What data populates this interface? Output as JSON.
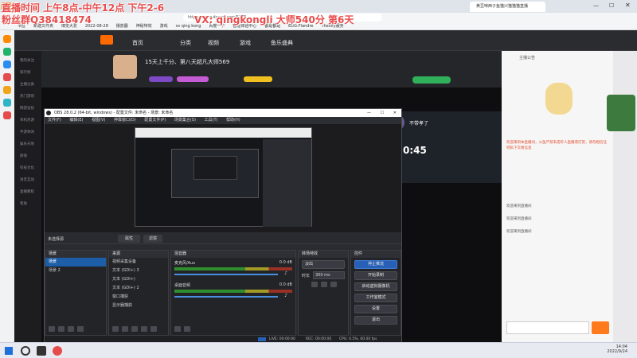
{
  "browser": {
    "tab_title": "黄豆咪西子鱼猫兴猫猫猫直播",
    "url": "https://www.douyu.com/5775",
    "bookmarks": [
      "书签",
      "新建文件夹",
      "博览大爱",
      "2022-08-28",
      "播放器",
      "神秘特效",
      "游戏",
      "sx qing kong",
      "百度一下",
      "智能体验中心",
      "都是都是",
      "EDG-Flandre",
      "Thestiy服务"
    ]
  },
  "overlay": {
    "line1": "直播时间 上午8点-中午12点 下午2-6",
    "line2": "粉丝群Q38418474",
    "line3": "VX: qingkongli 大师540分 第6天"
  },
  "site": {
    "nav": [
      "首页",
      "分类",
      "视频",
      "游戏",
      "鱼乐盛典"
    ],
    "sidebar": [
      "我的关注",
      "排行榜",
      "主播分类",
      "热门游戏",
      "网游竞技",
      "单机热游",
      "手游休闲",
      "娱乐天地",
      "颜值",
      "科技文化",
      "语音互动",
      "直播教程",
      "帮助"
    ],
    "room_title": "15天上千分、第八天超凡大师569",
    "streamer_card": {
      "name": "不带孝了",
      "timer": "0:45"
    },
    "right_panel": {
      "top_label": "主播公告",
      "chat": [
        "欢迎来到本直播间，斗鱼严禁未成年人直播或打赏，请勿相信任何私下交易信息",
        "欢迎来到直播间",
        "欢迎来到直播间",
        "欢迎来到直播间"
      ]
    }
  },
  "obs": {
    "title": "OBS 28.0.2 (64-bit, windows) - 配置文件: 未命名 - 场景: 未命名",
    "menu": [
      "文件(F)",
      "编辑(E)",
      "视图(V)",
      "停靠窗口(D)",
      "配置文件(P)",
      "场景集合(S)",
      "工具(T)",
      "帮助(H)"
    ],
    "source_bar": {
      "label": "未选择源",
      "props": "属性",
      "filters": "滤镜"
    },
    "docks": {
      "scenes": {
        "title": "场景",
        "items": [
          "场景",
          "场景 2"
        ]
      },
      "sources": {
        "title": "来源",
        "items": [
          "视频采集设备",
          "文本 (GDI+) 3",
          "文本 (GDI+)",
          "文本 (GDI+) 2",
          "窗口捕获",
          "显示器捕获"
        ]
      },
      "mixer": {
        "title": "混音器",
        "tracks": [
          {
            "name": "麦克风/Aux",
            "db": "0.0 dB"
          },
          {
            "name": "桌面音频",
            "db": "0.0 dB"
          }
        ]
      },
      "transitions": {
        "title": "转场特效",
        "mode": "淡出",
        "duration_label": "时长",
        "duration": "300 ms"
      },
      "controls": {
        "title": "控件",
        "buttons": [
          "停止推流",
          "开始录制",
          "启动虚拟摄像机",
          "工作室模式",
          "设置",
          "退出"
        ]
      }
    },
    "status": {
      "live": "LIVE: 00:00:00",
      "rec": "REC: 00:00:00",
      "cpu": "CPU: 0.5%, 60.00 fps"
    }
  },
  "taskbar": {
    "time": "14:04",
    "date": "2022/9/24"
  },
  "colors": {
    "accent": "#2860b8",
    "overlay": "#e84c4c",
    "selected": "#1c5ea8"
  }
}
